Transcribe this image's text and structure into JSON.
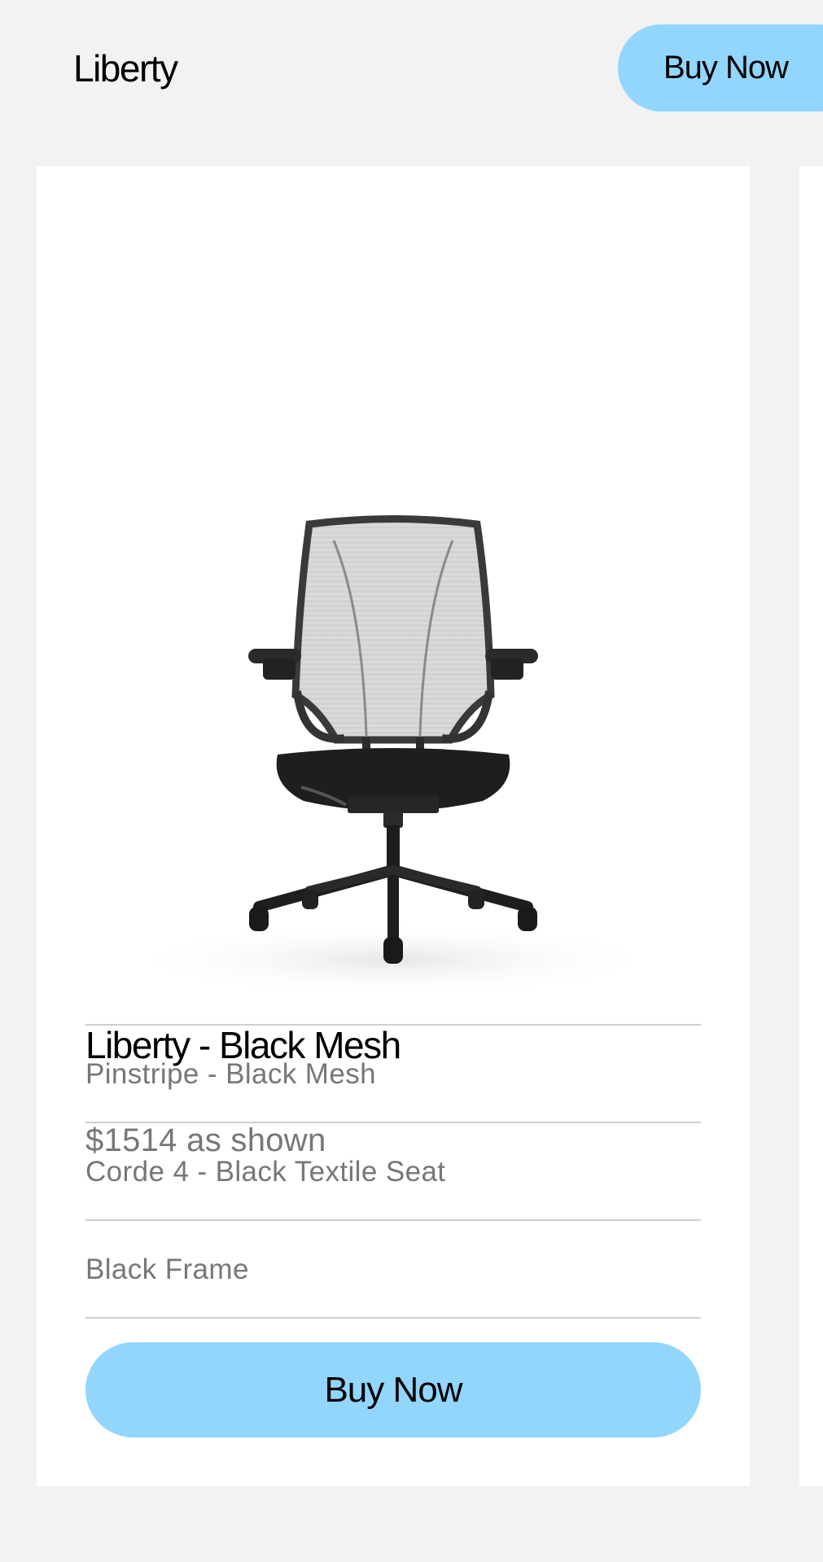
{
  "header": {
    "title": "Liberty",
    "buy_label": "Buy Now"
  },
  "product": {
    "name": "Liberty - Black Mesh",
    "price": "$1514 as shown",
    "options": [
      "Pinstripe - Black Mesh",
      "Corde 4 - Black Textile Seat",
      "Black Frame"
    ],
    "buy_label": "Buy Now",
    "image_icon": "office-chair-image"
  },
  "colors": {
    "background": "#f2f2f2",
    "card": "#ffffff",
    "accent": "#92d5fd",
    "muted_text": "#777777",
    "divider": "#cfcfcf"
  }
}
